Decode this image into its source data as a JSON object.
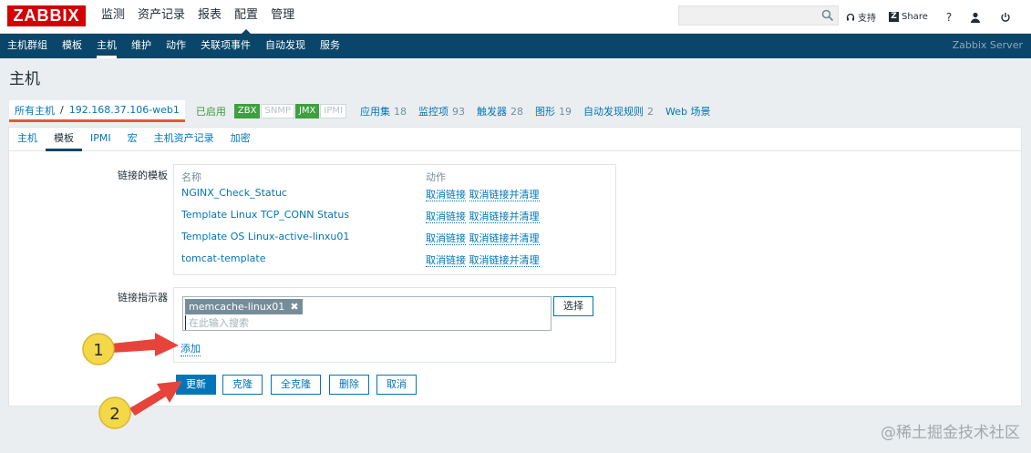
{
  "app": {
    "logo": "ZABBIX",
    "server_name": "Zabbix Server"
  },
  "main_nav": [
    {
      "label": "监测",
      "active": false
    },
    {
      "label": "资产记录",
      "active": false
    },
    {
      "label": "报表",
      "active": false
    },
    {
      "label": "配置",
      "active": true
    },
    {
      "label": "管理",
      "active": false
    }
  ],
  "header_tools": {
    "support": "支持",
    "share": "Share",
    "help": "?"
  },
  "sub_nav": [
    {
      "label": "主机群组",
      "active": false
    },
    {
      "label": "模板",
      "active": false
    },
    {
      "label": "主机",
      "active": true
    },
    {
      "label": "维护",
      "active": false
    },
    {
      "label": "动作",
      "active": false
    },
    {
      "label": "关联项事件",
      "active": false
    },
    {
      "label": "自动发现",
      "active": false
    },
    {
      "label": "服务",
      "active": false
    }
  ],
  "page": {
    "title": "主机"
  },
  "breadcrumb": {
    "all_hosts": "所有主机",
    "separator": "/",
    "host": "192.168.37.106-web1",
    "status": "已启用",
    "availability": [
      {
        "label": "ZBX",
        "on": true
      },
      {
        "label": "SNMP",
        "on": false
      },
      {
        "label": "JMX",
        "on": true
      },
      {
        "label": "IPMI",
        "on": false
      }
    ],
    "links": [
      {
        "label": "应用集",
        "count": "18"
      },
      {
        "label": "监控项",
        "count": "93"
      },
      {
        "label": "触发器",
        "count": "28"
      },
      {
        "label": "图形",
        "count": "19"
      },
      {
        "label": "自动发现规则",
        "count": "2"
      },
      {
        "label": "Web 场景",
        "count": ""
      }
    ]
  },
  "tabs": [
    {
      "label": "主机",
      "active": false
    },
    {
      "label": "模板",
      "active": true
    },
    {
      "label": "IPMI",
      "active": false
    },
    {
      "label": "宏",
      "active": false
    },
    {
      "label": "主机资产记录",
      "active": false
    },
    {
      "label": "加密",
      "active": false
    }
  ],
  "linked_templates": {
    "label": "链接的模板",
    "col_name": "名称",
    "col_action": "动作",
    "rows": [
      {
        "name": "NGINX_Check_Statuc",
        "unlink": "取消链接",
        "unlink_clear": "取消链接并清理"
      },
      {
        "name": "Template Linux TCP_CONN Status",
        "unlink": "取消链接",
        "unlink_clear": "取消链接并清理"
      },
      {
        "name": "Template OS Linux-active-linxu01",
        "unlink": "取消链接",
        "unlink_clear": "取消链接并清理"
      },
      {
        "name": "tomcat-template",
        "unlink": "取消链接",
        "unlink_clear": "取消链接并清理"
      }
    ]
  },
  "link_new": {
    "label": "链接指示器",
    "selected_tag": "memcache-linux01",
    "search_placeholder": "在此输入搜索",
    "select_button": "选择",
    "add_link": "添加"
  },
  "form_buttons": {
    "update": "更新",
    "clone": "克隆",
    "full_clone": "全克隆",
    "delete": "删除",
    "cancel": "取消"
  },
  "annotations": {
    "marker1": "1",
    "marker2": "2",
    "arrow_color": "#e8433a",
    "marker_color": "#f5d848"
  },
  "watermark": "@稀土掘金技术社区"
}
